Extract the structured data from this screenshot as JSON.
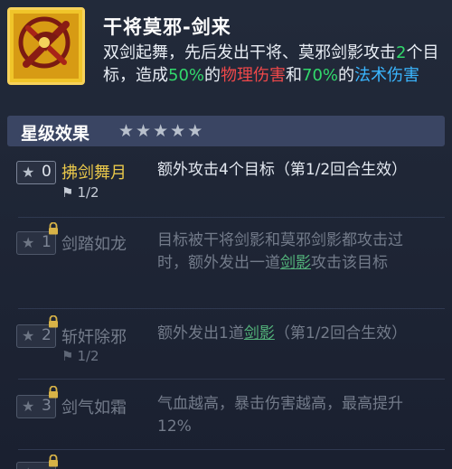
{
  "skill": {
    "icon": "dual-sword-emblem-icon",
    "title": "干将莫邪-剑来",
    "desc_parts": {
      "p1": "双剑起舞，先后发出干将、莫邪剑影攻击",
      "n_targets": "2",
      "p2": "个目标，造成",
      "phys_pct": "50%",
      "p3": "的",
      "phys_label": "物理伤害",
      "p4": "和",
      "magic_pct": "70%",
      "p5": "的",
      "magic_label": "法术伤害"
    }
  },
  "star_section": {
    "label": "星级效果",
    "stars": [
      "★",
      "★",
      "★",
      "★",
      "★"
    ]
  },
  "effects": [
    {
      "level": "0",
      "name": "拂剑舞月",
      "flag": "1/2",
      "desc": "额外攻击4个目标（第1/2回合生效）",
      "locked": false
    },
    {
      "level": "1",
      "name": "剑踏如龙",
      "desc_before": "目标被干将剑影和莫邪剑影都攻击过时，额外发出一道",
      "desc_link": "剑影",
      "desc_after": "攻击该目标",
      "locked": true
    },
    {
      "level": "2",
      "name": "斩奸除邪",
      "flag": "1/2",
      "desc_before": "额外发出1道",
      "desc_link": "剑影",
      "desc_after": "（第1/2回合生效）",
      "locked": true
    },
    {
      "level": "3",
      "name": "剑气如霜",
      "desc": "气血越高，暴击伤害越高，最高提升12%",
      "locked": true
    }
  ],
  "colors": {
    "background": "#1d2433",
    "header_bar": "#3a4563",
    "active_name": "#e8c74a",
    "green": "#32d96c",
    "red": "#f0484a",
    "blue": "#3ab6ff",
    "link": "#53b27a"
  }
}
